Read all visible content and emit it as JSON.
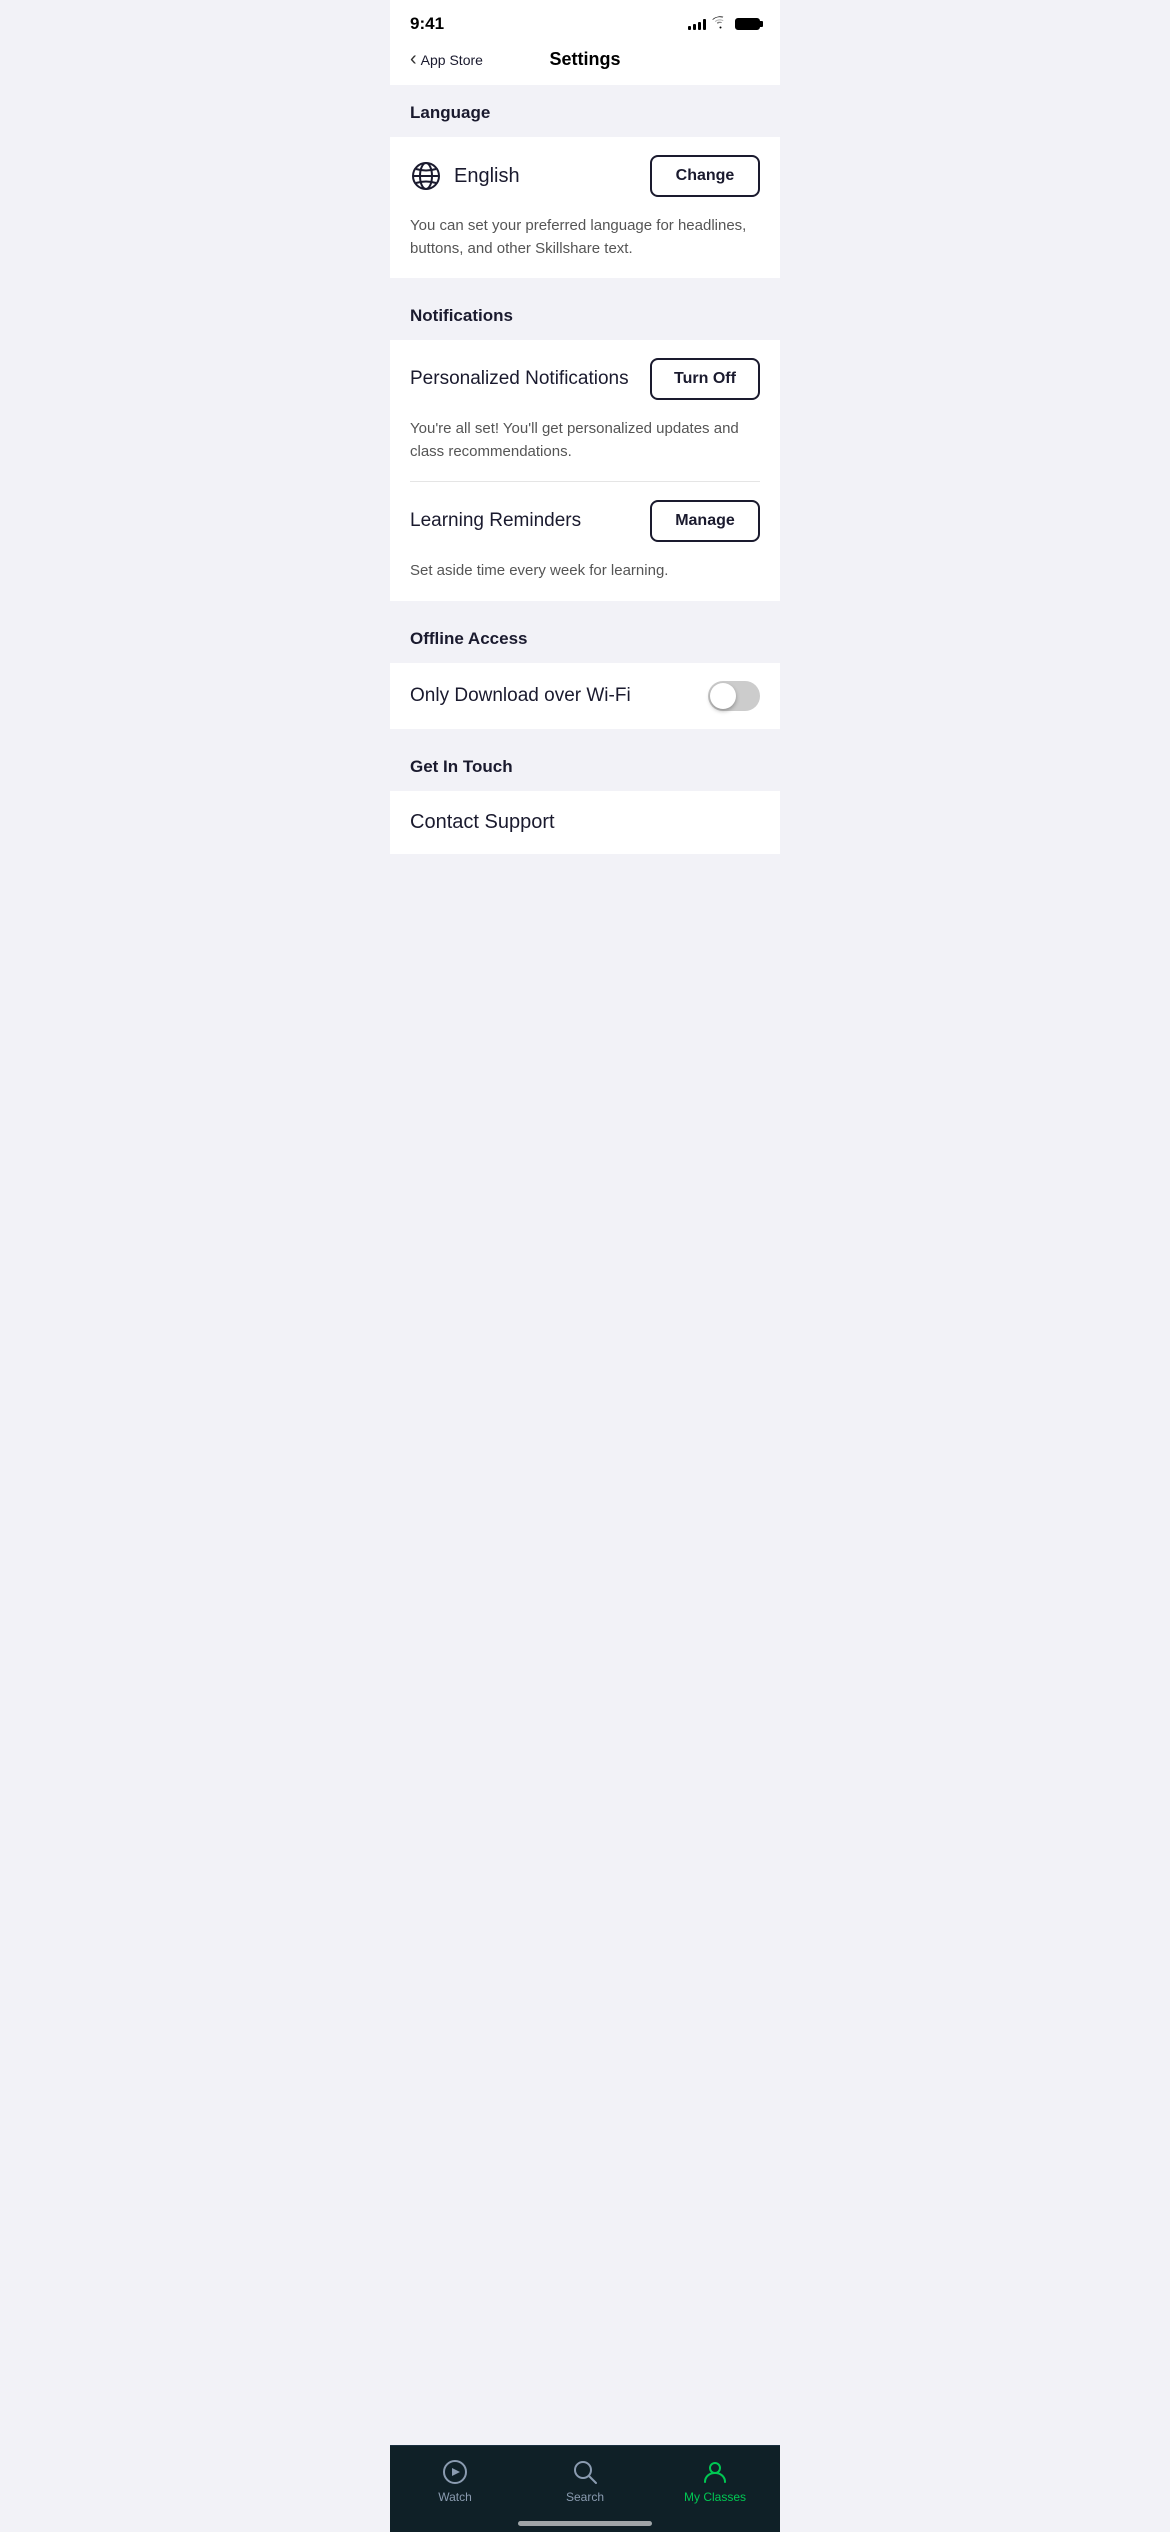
{
  "statusBar": {
    "time": "9:41",
    "appStore": "App Store"
  },
  "header": {
    "backLabel": "App Store",
    "title": "Settings"
  },
  "sections": {
    "language": {
      "heading": "Language",
      "currentLanguage": "English",
      "changeButtonLabel": "Change",
      "description": "You can set your preferred language for headlines, buttons, and other Skillshare text."
    },
    "notifications": {
      "heading": "Notifications",
      "personalizedNotifications": {
        "label": "Personalized Notifications",
        "buttonLabel": "Turn Off",
        "description": "You're all set! You'll get personalized updates and class recommendations."
      },
      "learningReminders": {
        "label": "Learning Reminders",
        "buttonLabel": "Manage",
        "description": "Set aside time every week for learning."
      }
    },
    "offlineAccess": {
      "heading": "Offline Access",
      "wifiOnly": {
        "label": "Only Download over Wi-Fi",
        "enabled": false
      }
    },
    "getInTouch": {
      "heading": "Get In Touch",
      "contactSupport": "Contact Support"
    }
  },
  "tabBar": {
    "items": [
      {
        "id": "watch",
        "label": "Watch",
        "active": false
      },
      {
        "id": "search",
        "label": "Search",
        "active": false
      },
      {
        "id": "my-classes",
        "label": "My Classes",
        "active": true
      }
    ]
  }
}
